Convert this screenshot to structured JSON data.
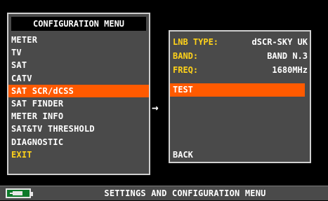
{
  "menu": {
    "title": "CONFIGURATION MENU",
    "items": [
      {
        "label": "METER"
      },
      {
        "label": "TV"
      },
      {
        "label": "SAT"
      },
      {
        "label": "CATV"
      },
      {
        "label": "SAT SCR/dCSS",
        "selected": true
      },
      {
        "label": "SAT FINDER"
      },
      {
        "label": "METER INFO"
      },
      {
        "label": "SAT&TV THRESHOLD"
      },
      {
        "label": "DIAGNOSTIC"
      },
      {
        "label": "EXIT"
      }
    ]
  },
  "arrow": "→",
  "submenu": {
    "lnb_type": {
      "label": "LNB TYPE:",
      "value": "dSCR-SKY UK"
    },
    "band": {
      "label": "BAND:",
      "value": "BAND N.3"
    },
    "freq": {
      "label": "FREQ:",
      "value": "1680MHz"
    },
    "test_label": "TEST",
    "back_label": "BACK"
  },
  "statusbar": {
    "text": "SETTINGS AND CONFIGURATION MENU",
    "battery_icon": "battery-charging-icon"
  },
  "colors": {
    "background": "#000000",
    "panel": "#4a4a4a",
    "highlight": "#ff5a00",
    "label_yellow": "#ffd21a",
    "text": "#ffffff",
    "battery_green": "#0e7a2a"
  }
}
